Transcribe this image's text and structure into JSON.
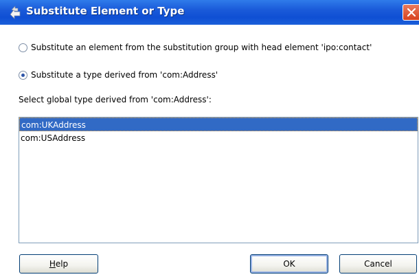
{
  "dialog": {
    "title": "Substitute Element or Type",
    "title_icon": "jdev-substitute-icon",
    "close_icon": "close-icon"
  },
  "options": {
    "element": {
      "label": "Substitute an element from the substitution group with head element 'ipo:contact'",
      "checked": false
    },
    "type": {
      "label": "Substitute a type derived from 'com:Address'",
      "checked": true
    }
  },
  "list": {
    "label": "Select global type derived from 'com:Address':",
    "items": [
      "com:UKAddress",
      "com:USAddress"
    ],
    "selected_index": 0
  },
  "buttons": {
    "help_mnemonic": "H",
    "help_rest": "elp",
    "ok": "OK",
    "cancel": "Cancel"
  },
  "colors": {
    "titlebar": "#0f4fd4",
    "selection": "#316ac5",
    "close": "#d7421f"
  }
}
